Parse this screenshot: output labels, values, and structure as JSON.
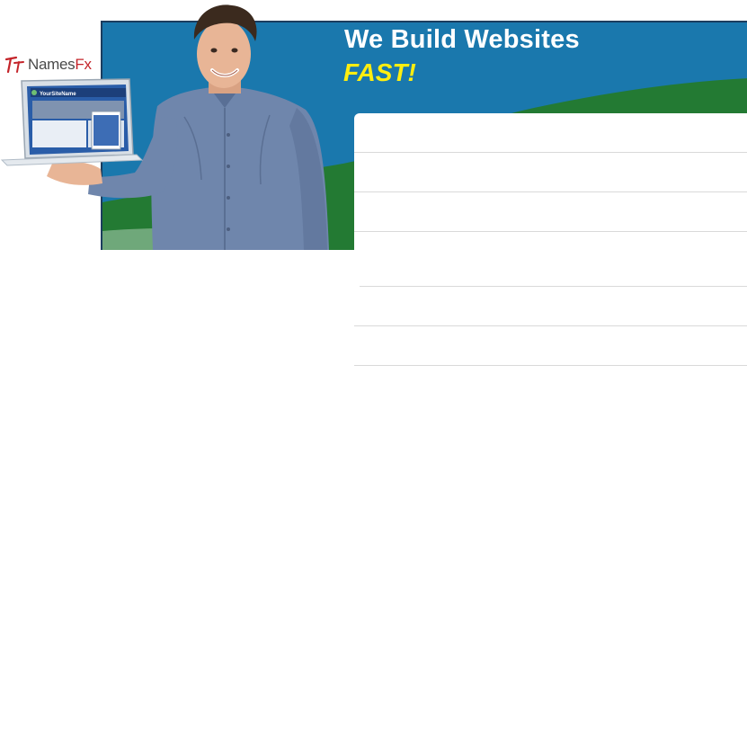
{
  "brand": {
    "logo_icon": "namesfx-logo-icon",
    "name": "Names",
    "suffix": "Fx",
    "accent_color": "#c4242a"
  },
  "hero": {
    "headline": "We Build Websites",
    "tagline": "FAST!",
    "headline_color": "#ffffff",
    "tagline_color": "#ffee10",
    "sky_color": "#1a78ad",
    "grass_color": "#237a33"
  },
  "laptop_screen": {
    "site_title": "YourSiteName"
  },
  "feature_list": {
    "items": [
      "",
      "",
      "",
      "",
      "",
      ""
    ]
  }
}
